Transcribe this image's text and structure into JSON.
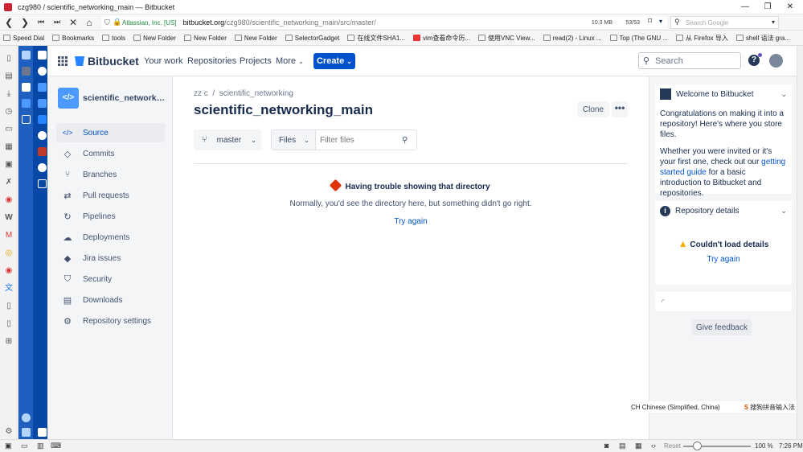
{
  "window": {
    "title": "czg980 / scientific_networking_main — Bitbucket"
  },
  "browser": {
    "site_identity": "Atlassian, Inc. [US]",
    "url_host": "bitbucket.org",
    "url_path": "/czg980/scientific_networking_main/src/master/",
    "memory": "10.3 MB",
    "tab_count": "53/53",
    "search_placeholder": "Search Google"
  },
  "bookmarks": [
    "Speed Dial",
    "Bookmarks",
    "tools",
    "New Folder",
    "New Folder",
    "New Folder",
    "SelectorGadget",
    "在线文件SHA1...",
    "vim查看命令历...",
    "使用VNC View...",
    "read(2) - Linux ...",
    "Top (The GNU ...",
    "从 Firefox 导入",
    "shell 语法 gra..."
  ],
  "header": {
    "logo": "Bitbucket",
    "nav": [
      "Your work",
      "Repositories",
      "Projects",
      "More"
    ],
    "create": "Create",
    "search_placeholder": "Search",
    "help": "?"
  },
  "sidebar": {
    "repo_name": "scientific_networking_main",
    "items": [
      {
        "label": "Source",
        "icon": "</>"
      },
      {
        "label": "Commits",
        "icon": "◇"
      },
      {
        "label": "Branches",
        "icon": "⑂"
      },
      {
        "label": "Pull requests",
        "icon": "⇄"
      },
      {
        "label": "Pipelines",
        "icon": "↻"
      },
      {
        "label": "Deployments",
        "icon": "☁"
      },
      {
        "label": "Jira issues",
        "icon": "◆"
      },
      {
        "label": "Security",
        "icon": "⛉"
      },
      {
        "label": "Downloads",
        "icon": "▤"
      },
      {
        "label": "Repository settings",
        "icon": "⚙"
      }
    ]
  },
  "main": {
    "breadcrumb_owner": "zz c",
    "breadcrumb_repo": "scientific_networking",
    "title": "scientific_networking_main",
    "clone": "Clone",
    "more": "•••",
    "branch": "master",
    "files_dropdown": "Files",
    "filter_placeholder": "Filter files",
    "error_title": "Having trouble showing that directory",
    "error_message": "Normally, you'd see the directory here, but something didn't go right.",
    "try_again": "Try again"
  },
  "right_panel": {
    "welcome_title": "Welcome to Bitbucket",
    "welcome_p1": "Congratulations on making it into a repository! Here's where you store files.",
    "welcome_p2_a": "Whether you were invited or it's your first one, check out our ",
    "welcome_p2_link": "getting started guide",
    "welcome_p2_b": " for a basic introduction to Bitbucket and repositories.",
    "details_title": "Repository details",
    "details_error": "Couldn't load details",
    "details_try_again": "Try again",
    "feedback": "Give feedback"
  },
  "ime": {
    "lang": "CH Chinese (Simplified, China)",
    "ime_name": "搜狗拼音输入法"
  },
  "statusbar": {
    "reset": "Reset",
    "zoom": "100 %",
    "time": "7:26 PM"
  }
}
